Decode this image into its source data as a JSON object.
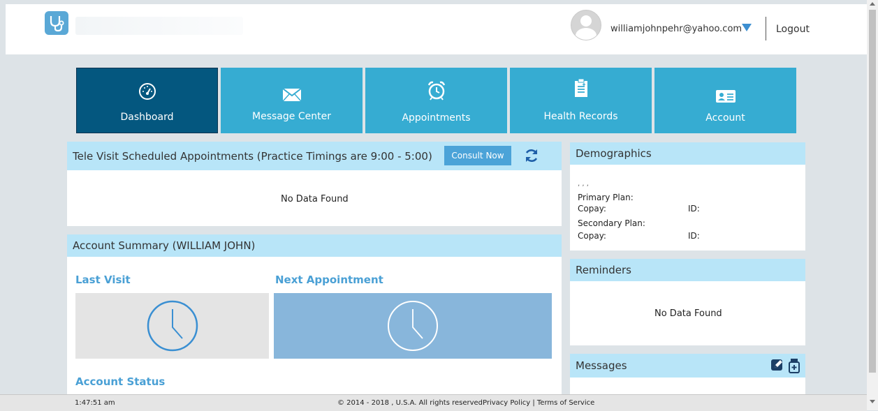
{
  "header": {
    "user_email": "williamjohnpehr@yahoo.com",
    "logout_label": "Logout"
  },
  "nav": {
    "tiles": [
      {
        "label": "Dashboard",
        "icon": "dashboard-gauge-icon",
        "active": true
      },
      {
        "label": "Message Center",
        "icon": "envelope-icon",
        "active": false
      },
      {
        "label": "Appointments",
        "icon": "alarm-clock-icon",
        "active": false
      },
      {
        "label": "Health Records",
        "icon": "clipboard-icon",
        "active": false
      },
      {
        "label": "Account",
        "icon": "id-card-icon",
        "active": false
      }
    ]
  },
  "televisit": {
    "title": "Tele Visit Scheduled Appointments (Practice Timings are 9:00 - 5:00)",
    "consult_label": "Consult Now",
    "empty_text": "No Data Found"
  },
  "account_summary": {
    "title": "Account Summary (WILLIAM JOHN)",
    "last_visit_label": "Last Visit",
    "next_appointment_label": "Next Appointment",
    "account_status_label": "Account Status"
  },
  "demographics": {
    "title": "Demographics",
    "name_line": ", , ,",
    "primary_plan_label": "Primary Plan:",
    "copay_label_1": "Copay:",
    "id_label_1": "ID:",
    "secondary_plan_label": "Secondary Plan:",
    "copay_label_2": "Copay:",
    "id_label_2": "ID:"
  },
  "reminders": {
    "title": "Reminders",
    "empty_text": "No Data Found"
  },
  "messages": {
    "title": "Messages"
  },
  "footer": {
    "time": "1:47:51 am",
    "copyright": "© 2014 - 2018 , U.S.A. All rights reserved.",
    "links": "Privacy Policy | Terms of Service"
  },
  "colors": {
    "tile": "#36acd2",
    "tile_active": "#04577f",
    "panel_header": "#b8e5f8",
    "accent_blue": "#4aa0d5"
  }
}
